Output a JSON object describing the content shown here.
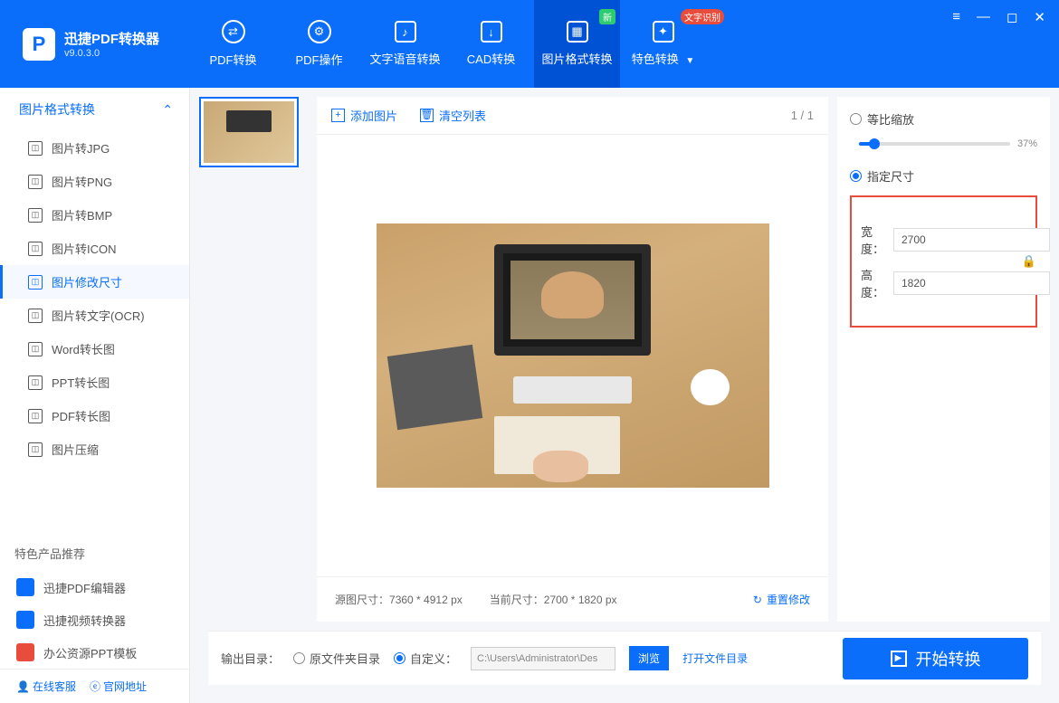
{
  "app": {
    "name": "迅捷PDF转换器",
    "version": "v9.0.3.0"
  },
  "header_tabs": [
    {
      "label": "PDF转换",
      "icon": "⇄"
    },
    {
      "label": "PDF操作",
      "icon": "⚙"
    },
    {
      "label": "文字语音转换",
      "icon": "♪"
    },
    {
      "label": "CAD转换",
      "icon": "↓"
    },
    {
      "label": "图片格式转换",
      "icon": "▦",
      "active": true,
      "badge_new": "新"
    },
    {
      "label": "特色转换",
      "icon": "✦",
      "caret": true,
      "badge_ocr": "文字识别"
    }
  ],
  "sidebar": {
    "group": "图片格式转换",
    "items": [
      {
        "label": "图片转JPG"
      },
      {
        "label": "图片转PNG"
      },
      {
        "label": "图片转BMP"
      },
      {
        "label": "图片转ICON"
      },
      {
        "label": "图片修改尺寸",
        "active": true
      },
      {
        "label": "图片转文字(OCR)"
      },
      {
        "label": "Word转长图"
      },
      {
        "label": "PPT转长图"
      },
      {
        "label": "PDF转长图"
      },
      {
        "label": "图片压缩"
      }
    ],
    "promo_title": "特色产品推荐",
    "promos": [
      {
        "label": "迅捷PDF编辑器",
        "color": "#0a6efa"
      },
      {
        "label": "迅捷视频转换器",
        "color": "#0a6efa"
      },
      {
        "label": "办公资源PPT模板",
        "color": "#e74c3c"
      }
    ],
    "footer": {
      "service": "在线客服",
      "site": "官网地址"
    }
  },
  "toolbar": {
    "add": "添加图片",
    "clear": "清空列表",
    "page": "1 / 1"
  },
  "info": {
    "src_label": "源图尺寸：",
    "src_val": "7360 * 4912 px",
    "cur_label": "当前尺寸：",
    "cur_val": "2700 * 1820 px",
    "reset": "重置修改"
  },
  "settings": {
    "scale_label": "等比缩放",
    "scale_pct": "37%",
    "scale_val": 37,
    "size_label": "指定尺寸",
    "width_label": "宽度：",
    "width_val": "2700",
    "height_label": "高度：",
    "height_val": "1820"
  },
  "output": {
    "label": "输出目录：",
    "opt1": "原文件夹目录",
    "opt2": "自定义：",
    "path": "C:\\Users\\Administrator\\Des",
    "browse": "浏览",
    "opendir": "打开文件目录",
    "start": "开始转换"
  }
}
